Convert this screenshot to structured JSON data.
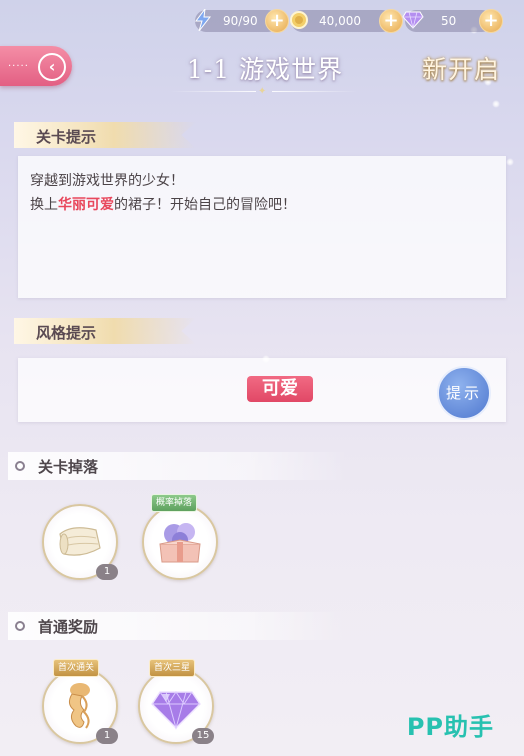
{
  "resources": {
    "energy": "90/90",
    "coins": "40,000",
    "gems": "50"
  },
  "header": {
    "title": "1-1 游戏世界",
    "new_open": "新开启"
  },
  "level_hint": {
    "label": "关卡提示",
    "line1": "穿越到游戏世界的少女！",
    "line2_prefix": "换上",
    "line2_highlight": "华丽可爱",
    "line2_suffix": "的裙子！开始自己的冒险吧！"
  },
  "style_hint": {
    "label": "风格提示",
    "tag": "可爱",
    "hint_button": "提示"
  },
  "drops": {
    "label": "关卡掉落",
    "items": [
      {
        "icon": "fabric-icon",
        "count": "1"
      },
      {
        "icon": "gift-box-icon",
        "tag": "概率掉落"
      }
    ]
  },
  "first_clear": {
    "label": "首通奖励",
    "items": [
      {
        "icon": "hair-icon",
        "tag": "首次通关",
        "count": "1"
      },
      {
        "icon": "diamond-icon",
        "tag": "首次三星",
        "count": "15"
      }
    ]
  },
  "watermark": "PP助手",
  "colors": {
    "accent_pink": "#e35f83",
    "highlight_red": "#e8475c",
    "hint_blue": "#4f78cf",
    "gold": "#e6a74b"
  }
}
